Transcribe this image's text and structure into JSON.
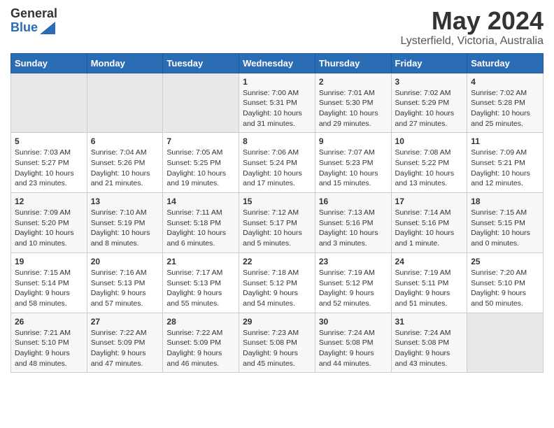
{
  "header": {
    "logo_general": "General",
    "logo_blue": "Blue",
    "title": "May 2024",
    "subtitle": "Lysterfield, Victoria, Australia"
  },
  "weekdays": [
    "Sunday",
    "Monday",
    "Tuesday",
    "Wednesday",
    "Thursday",
    "Friday",
    "Saturday"
  ],
  "weeks": [
    [
      {
        "day": "",
        "info": ""
      },
      {
        "day": "",
        "info": ""
      },
      {
        "day": "",
        "info": ""
      },
      {
        "day": "1",
        "info": "Sunrise: 7:00 AM\nSunset: 5:31 PM\nDaylight: 10 hours\nand 31 minutes."
      },
      {
        "day": "2",
        "info": "Sunrise: 7:01 AM\nSunset: 5:30 PM\nDaylight: 10 hours\nand 29 minutes."
      },
      {
        "day": "3",
        "info": "Sunrise: 7:02 AM\nSunset: 5:29 PM\nDaylight: 10 hours\nand 27 minutes."
      },
      {
        "day": "4",
        "info": "Sunrise: 7:02 AM\nSunset: 5:28 PM\nDaylight: 10 hours\nand 25 minutes."
      }
    ],
    [
      {
        "day": "5",
        "info": "Sunrise: 7:03 AM\nSunset: 5:27 PM\nDaylight: 10 hours\nand 23 minutes."
      },
      {
        "day": "6",
        "info": "Sunrise: 7:04 AM\nSunset: 5:26 PM\nDaylight: 10 hours\nand 21 minutes."
      },
      {
        "day": "7",
        "info": "Sunrise: 7:05 AM\nSunset: 5:25 PM\nDaylight: 10 hours\nand 19 minutes."
      },
      {
        "day": "8",
        "info": "Sunrise: 7:06 AM\nSunset: 5:24 PM\nDaylight: 10 hours\nand 17 minutes."
      },
      {
        "day": "9",
        "info": "Sunrise: 7:07 AM\nSunset: 5:23 PM\nDaylight: 10 hours\nand 15 minutes."
      },
      {
        "day": "10",
        "info": "Sunrise: 7:08 AM\nSunset: 5:22 PM\nDaylight: 10 hours\nand 13 minutes."
      },
      {
        "day": "11",
        "info": "Sunrise: 7:09 AM\nSunset: 5:21 PM\nDaylight: 10 hours\nand 12 minutes."
      }
    ],
    [
      {
        "day": "12",
        "info": "Sunrise: 7:09 AM\nSunset: 5:20 PM\nDaylight: 10 hours\nand 10 minutes."
      },
      {
        "day": "13",
        "info": "Sunrise: 7:10 AM\nSunset: 5:19 PM\nDaylight: 10 hours\nand 8 minutes."
      },
      {
        "day": "14",
        "info": "Sunrise: 7:11 AM\nSunset: 5:18 PM\nDaylight: 10 hours\nand 6 minutes."
      },
      {
        "day": "15",
        "info": "Sunrise: 7:12 AM\nSunset: 5:17 PM\nDaylight: 10 hours\nand 5 minutes."
      },
      {
        "day": "16",
        "info": "Sunrise: 7:13 AM\nSunset: 5:16 PM\nDaylight: 10 hours\nand 3 minutes."
      },
      {
        "day": "17",
        "info": "Sunrise: 7:14 AM\nSunset: 5:16 PM\nDaylight: 10 hours\nand 1 minute."
      },
      {
        "day": "18",
        "info": "Sunrise: 7:15 AM\nSunset: 5:15 PM\nDaylight: 10 hours\nand 0 minutes."
      }
    ],
    [
      {
        "day": "19",
        "info": "Sunrise: 7:15 AM\nSunset: 5:14 PM\nDaylight: 9 hours\nand 58 minutes."
      },
      {
        "day": "20",
        "info": "Sunrise: 7:16 AM\nSunset: 5:13 PM\nDaylight: 9 hours\nand 57 minutes."
      },
      {
        "day": "21",
        "info": "Sunrise: 7:17 AM\nSunset: 5:13 PM\nDaylight: 9 hours\nand 55 minutes."
      },
      {
        "day": "22",
        "info": "Sunrise: 7:18 AM\nSunset: 5:12 PM\nDaylight: 9 hours\nand 54 minutes."
      },
      {
        "day": "23",
        "info": "Sunrise: 7:19 AM\nSunset: 5:12 PM\nDaylight: 9 hours\nand 52 minutes."
      },
      {
        "day": "24",
        "info": "Sunrise: 7:19 AM\nSunset: 5:11 PM\nDaylight: 9 hours\nand 51 minutes."
      },
      {
        "day": "25",
        "info": "Sunrise: 7:20 AM\nSunset: 5:10 PM\nDaylight: 9 hours\nand 50 minutes."
      }
    ],
    [
      {
        "day": "26",
        "info": "Sunrise: 7:21 AM\nSunset: 5:10 PM\nDaylight: 9 hours\nand 48 minutes."
      },
      {
        "day": "27",
        "info": "Sunrise: 7:22 AM\nSunset: 5:09 PM\nDaylight: 9 hours\nand 47 minutes."
      },
      {
        "day": "28",
        "info": "Sunrise: 7:22 AM\nSunset: 5:09 PM\nDaylight: 9 hours\nand 46 minutes."
      },
      {
        "day": "29",
        "info": "Sunrise: 7:23 AM\nSunset: 5:08 PM\nDaylight: 9 hours\nand 45 minutes."
      },
      {
        "day": "30",
        "info": "Sunrise: 7:24 AM\nSunset: 5:08 PM\nDaylight: 9 hours\nand 44 minutes."
      },
      {
        "day": "31",
        "info": "Sunrise: 7:24 AM\nSunset: 5:08 PM\nDaylight: 9 hours\nand 43 minutes."
      },
      {
        "day": "",
        "info": ""
      }
    ]
  ]
}
